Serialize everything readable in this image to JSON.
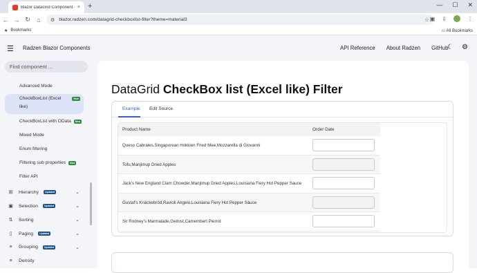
{
  "browser": {
    "tab_title": "Blazor DataGrid Component - I",
    "tab_close": "×",
    "new_tab": "+",
    "url": "blazor.radzen.com/datagrid-checkboxlist-filter?theme=material3",
    "bookmarks_label": "Bookmarks",
    "all_bookmarks_label": "All Bookmarks"
  },
  "header": {
    "brand": "Radzen Blazor Components",
    "nav": [
      "API Reference",
      "About Radzen",
      "GitHub"
    ]
  },
  "sidebar": {
    "search_placeholder": "Find component ...",
    "items": [
      {
        "label": "Advanced Mode"
      },
      {
        "label": "CheckBoxList (Excel",
        "label2": "like)",
        "badge": "New"
      },
      {
        "label": "CheckBoxList with OData",
        "badge": "New"
      },
      {
        "label": "Mixed Mode"
      },
      {
        "label": "Enum filtering"
      },
      {
        "label": "Filtering sub properties",
        "badge": "New"
      },
      {
        "label": "Filter API"
      }
    ],
    "groups": [
      {
        "label": "Hierarchy",
        "badge": "Updated"
      },
      {
        "label": "Selection",
        "badge": "Updated"
      },
      {
        "label": "Sorting"
      },
      {
        "label": "Paging",
        "badge": "Updated"
      },
      {
        "label": "Grouping",
        "badge": "Updated"
      },
      {
        "label": "Density"
      }
    ]
  },
  "main": {
    "title_light": "DataGrid ",
    "title_bold": "CheckBox list (Excel like) Filter",
    "tabs": [
      "Example",
      "Edit Source"
    ],
    "columns": [
      "Product Name",
      "Order Date"
    ],
    "rows": [
      "Queso Cabrales,Singaporean Hokkien Fried Mee,Mozzarella di Giovanni",
      "Tofu,Manjimup Dried Apples",
      "Jack's New England Clam Chowder,Manjimup Dried Apples,Louisiana Fiery Hot Pepper Sauce",
      "Gustaf's Knäckebröd,Ravioli Angelo,Louisiana Fiery Hot Pepper Sauce",
      "Sir Rodney's Marmalade,Geitost,Camembert Pierrot"
    ]
  },
  "colors": {
    "accent": "#2f5fd0",
    "active_nav": "#dde3f7",
    "badge_new": "#2e8b3d",
    "badge_updated": "#1d4d8c"
  }
}
